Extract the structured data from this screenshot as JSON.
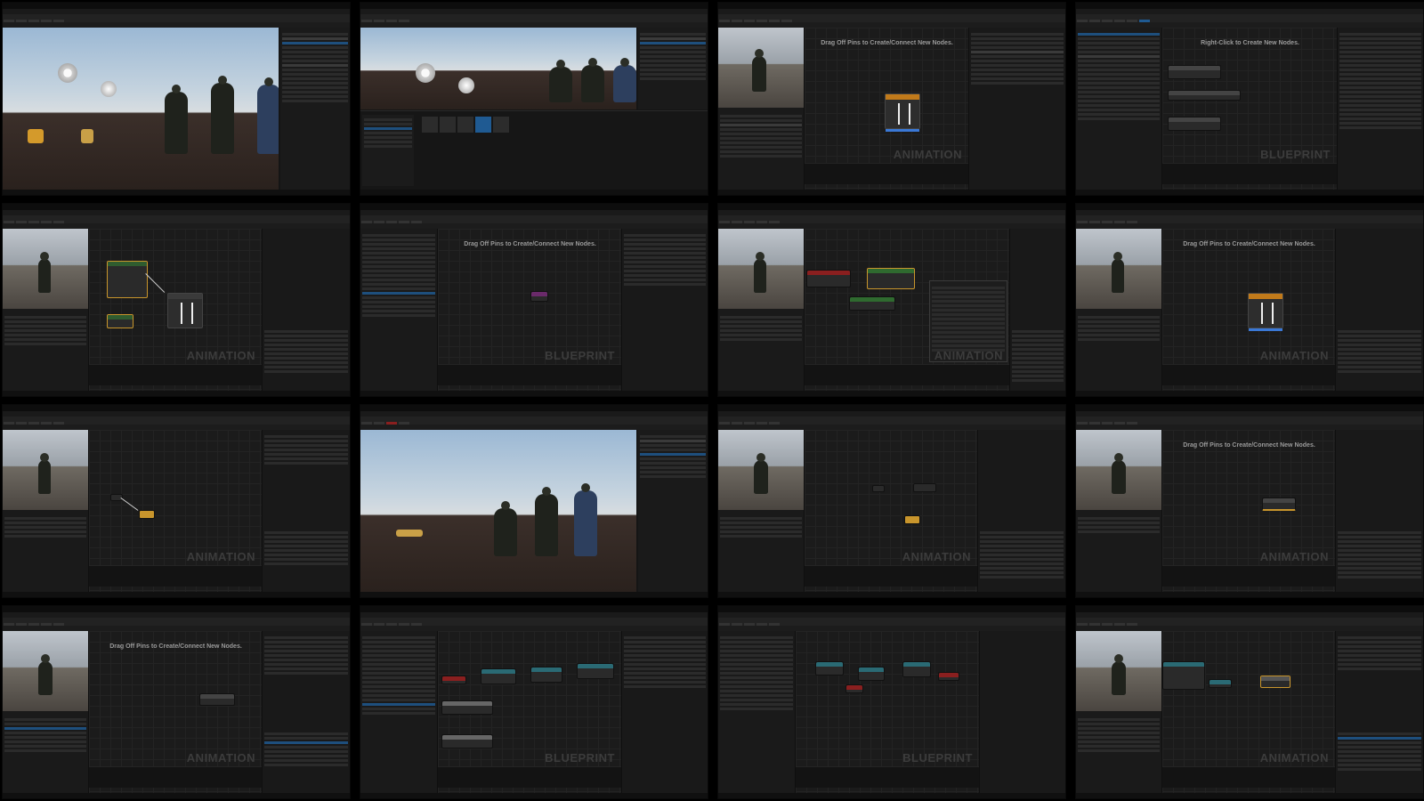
{
  "hints": {
    "drag": "Drag Off Pins to Create/Connect New Nodes.",
    "right_click": "Right-Click to Create New Nodes."
  },
  "watermarks": {
    "animation": "ANIMATION",
    "blueprint": "BLUEPRINT"
  },
  "tiles": [
    {
      "id": 1,
      "kind": "viewport"
    },
    {
      "id": 2,
      "kind": "viewport-content-browser"
    },
    {
      "id": 3,
      "kind": "anim-graph",
      "hint": "drag",
      "watermark": "animation"
    },
    {
      "id": 4,
      "kind": "blueprint-graph",
      "hint": "right_click",
      "watermark": "blueprint"
    },
    {
      "id": 5,
      "kind": "anim-graph",
      "watermark": "animation"
    },
    {
      "id": 6,
      "kind": "blueprint-graph",
      "hint": "drag",
      "watermark": "blueprint"
    },
    {
      "id": 7,
      "kind": "anim-graph",
      "watermark": "animation"
    },
    {
      "id": 8,
      "kind": "anim-graph",
      "hint": "drag",
      "watermark": "animation"
    },
    {
      "id": 9,
      "kind": "anim-graph",
      "watermark": "animation"
    },
    {
      "id": 10,
      "kind": "viewport"
    },
    {
      "id": 11,
      "kind": "anim-graph",
      "watermark": "animation"
    },
    {
      "id": 12,
      "kind": "anim-graph",
      "hint": "drag",
      "watermark": "animation"
    },
    {
      "id": 13,
      "kind": "anim-graph",
      "hint": "drag",
      "watermark": "animation"
    },
    {
      "id": 14,
      "kind": "blueprint-graph",
      "watermark": "blueprint"
    },
    {
      "id": 15,
      "kind": "blueprint-graph",
      "watermark": "blueprint"
    },
    {
      "id": 16,
      "kind": "anim-graph",
      "watermark": "animation"
    }
  ],
  "colors": {
    "accent": "#1f5a92",
    "pose_bar": "#c17a1a",
    "event_node": "#8a1f1f",
    "function_node": "#2a6a74",
    "state_node": "#c8952c"
  }
}
